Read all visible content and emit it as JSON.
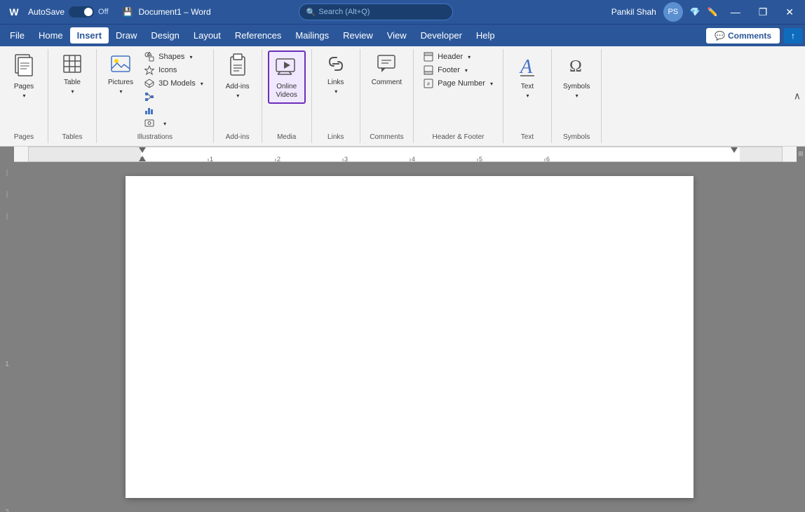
{
  "titleBar": {
    "appName": "Word",
    "autoSave": "AutoSave",
    "toggleState": "Off",
    "docTitle": "Document1 – Word",
    "searchPlaceholder": "Search (Alt+Q)",
    "userName": "Pankil Shah",
    "minimizeBtn": "—",
    "restoreBtn": "❐",
    "closeBtn": "✕"
  },
  "menuBar": {
    "items": [
      "File",
      "Home",
      "Insert",
      "Draw",
      "Design",
      "Layout",
      "References",
      "Mailings",
      "Review",
      "View",
      "Developer",
      "Help"
    ],
    "activeItem": "Insert",
    "commentsBtn": "Comments",
    "shareIcon": "↑"
  },
  "ribbon": {
    "groups": [
      {
        "name": "Pages",
        "label": "Pages",
        "buttons": [
          {
            "id": "pages",
            "icon": "📄",
            "label": "Pages",
            "hasDropdown": true
          }
        ]
      },
      {
        "name": "Tables",
        "label": "Tables",
        "buttons": [
          {
            "id": "table",
            "icon": "⊞",
            "label": "Table",
            "hasDropdown": true
          }
        ]
      },
      {
        "name": "Illustrations",
        "label": "Illustrations",
        "buttons": [
          {
            "id": "pictures",
            "icon": "🖼",
            "label": "Pictures",
            "hasDropdown": true
          },
          {
            "id": "shapes",
            "icon": "⬡",
            "label": "Shapes",
            "hasDropdown": true
          },
          {
            "id": "icons",
            "icon": "★",
            "label": "Icons",
            "hasDropdown": false
          },
          {
            "id": "3d-models",
            "icon": "🧊",
            "label": "3D Models",
            "hasDropdown": true
          },
          {
            "id": "smartart",
            "icon": "🔷",
            "label": "",
            "hasDropdown": false
          },
          {
            "id": "chart",
            "icon": "📊",
            "label": "",
            "hasDropdown": false
          },
          {
            "id": "screenshot",
            "icon": "📷",
            "label": "",
            "hasDropdown": true
          }
        ]
      },
      {
        "name": "Add-ins",
        "label": "Add-ins",
        "buttons": [
          {
            "id": "addins",
            "icon": "🧩",
            "label": "Add-ins",
            "hasDropdown": true
          }
        ]
      },
      {
        "name": "Media",
        "label": "Media",
        "buttons": [
          {
            "id": "online-videos",
            "icon": "▶",
            "label": "Online\nVideos",
            "hasDropdown": false,
            "highlighted": true
          }
        ]
      },
      {
        "name": "Links",
        "label": "Links",
        "buttons": [
          {
            "id": "links",
            "icon": "🔗",
            "label": "Links",
            "hasDropdown": true
          }
        ]
      },
      {
        "name": "Comments",
        "label": "Comments",
        "buttons": [
          {
            "id": "comment",
            "icon": "💬",
            "label": "Comment",
            "hasDropdown": false
          }
        ]
      },
      {
        "name": "Header & Footer",
        "label": "Header & Footer",
        "buttons": [
          {
            "id": "header",
            "icon": "⬛",
            "label": "Header",
            "hasDropdown": true
          },
          {
            "id": "footer",
            "icon": "⬛",
            "label": "Footer",
            "hasDropdown": true
          },
          {
            "id": "page-number",
            "icon": "⬛",
            "label": "Page Number",
            "hasDropdown": true
          }
        ]
      },
      {
        "name": "Text",
        "label": "Text",
        "buttons": [
          {
            "id": "text",
            "icon": "A",
            "label": "Text",
            "hasDropdown": true
          }
        ]
      },
      {
        "name": "Symbols",
        "label": "Symbols",
        "buttons": [
          {
            "id": "symbols",
            "icon": "Ω",
            "label": "Symbols",
            "hasDropdown": true
          }
        ]
      }
    ],
    "collapseBtn": "^"
  },
  "document": {
    "pageBackground": "#ffffff"
  }
}
